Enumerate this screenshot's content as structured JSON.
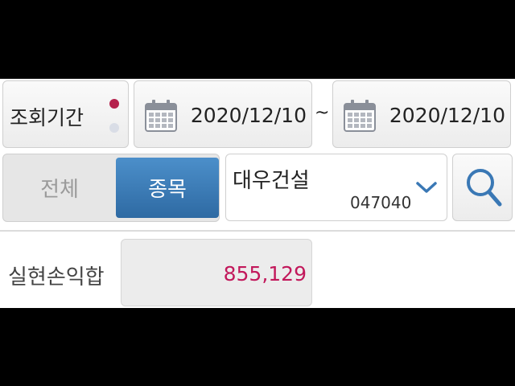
{
  "period": {
    "label": "조회기간"
  },
  "date_range": {
    "start": "2020/12/10",
    "separator": "~",
    "end": "2020/12/10"
  },
  "scope_toggle": {
    "all_label": "전체",
    "stock_label": "종목",
    "selected": "stock"
  },
  "stock": {
    "name": "대우건설",
    "code": "047040"
  },
  "summary": {
    "label": "실현손익합",
    "value": "855,129"
  },
  "colors": {
    "accent_blue": "#3a78b5",
    "value_pink": "#c2185b",
    "dot_active": "#b5224d"
  },
  "icons": {
    "calendar": "calendar-icon",
    "dropdown": "chevron-down-icon",
    "search": "search-icon"
  }
}
